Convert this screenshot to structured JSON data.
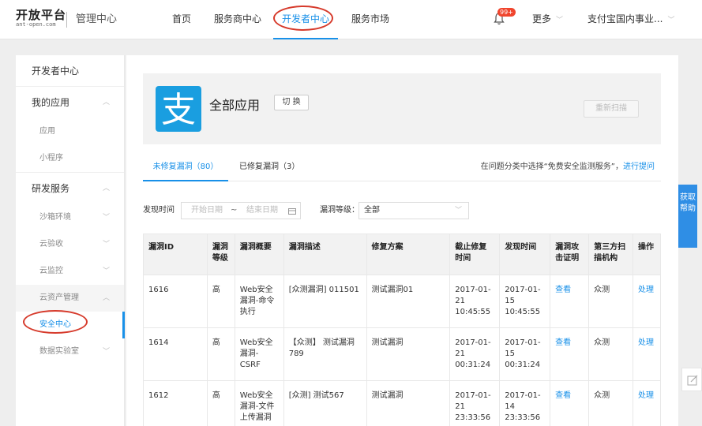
{
  "brand": {
    "logo_main": "开放平台",
    "logo_sub": "ant-open.com",
    "admin": "管理中心"
  },
  "nav": {
    "home": "首页",
    "service_center": "服务商中心",
    "dev_center": "开发者中心",
    "market": "服务市场"
  },
  "header": {
    "badge": "99+",
    "more": "更多",
    "account": "支付宝国内事业..."
  },
  "sidebar": {
    "title": "开发者中心",
    "my_apps": "我的应用",
    "apps": "应用",
    "mini": "小程序",
    "rd_services": "研发服务",
    "sandbox": "沙箱环境",
    "cloud_accept": "云验收",
    "cloud_monitor": "云监控",
    "cloud_assets": "云资产管理",
    "security": "安全中心",
    "data_lab": "数据实验室"
  },
  "app": {
    "logo_glyph": "支",
    "title": "全部应用",
    "switch": "切 换",
    "rescan": "重新扫描"
  },
  "tabs": {
    "unfixed": "未修复漏洞（80）",
    "fixed": "已修复漏洞（3）",
    "hint": "在问题分类中选择“免费安全监测服务”，",
    "hint_link": "进行提问"
  },
  "filter": {
    "time_label": "发现时间",
    "start": "开始日期",
    "tilde": "~",
    "end": "结束日期",
    "level_label": "漏洞等级：",
    "level_value": "全部"
  },
  "table": {
    "headers": [
      "漏洞ID",
      "漏洞等级",
      "漏洞概要",
      "漏洞描述",
      "修复方案",
      "截止修复时间",
      "发现时间",
      "漏洞攻击证明",
      "第三方扫描机构",
      "操作"
    ],
    "rows": [
      [
        "1616",
        "高",
        "Web安全漏洞-命令执行",
        "[众测漏洞] 011501",
        "测试漏洞01",
        "2017-01-21 10:45:55",
        "2017-01-15 10:45:55",
        "查看",
        "众测",
        "处理"
      ],
      [
        "1614",
        "高",
        "Web安全漏洞-CSRF",
        "【众测】 测试漏洞789",
        "测试漏洞",
        "2017-01-21 00:31:24",
        "2017-01-15 00:31:24",
        "查看",
        "众测",
        "处理"
      ],
      [
        "1612",
        "高",
        "Web安全漏洞-文件上传漏洞",
        "[众测] 测试567",
        "测试漏洞",
        "2017-01-21 23:33:56",
        "2017-01-14 23:33:56",
        "查看",
        "众测",
        "处理"
      ]
    ]
  },
  "help": {
    "label": "获取帮助"
  },
  "colors": {
    "accent": "#1890e8",
    "annotation": "#d63a2b",
    "alipay": "#1a9ee0"
  }
}
